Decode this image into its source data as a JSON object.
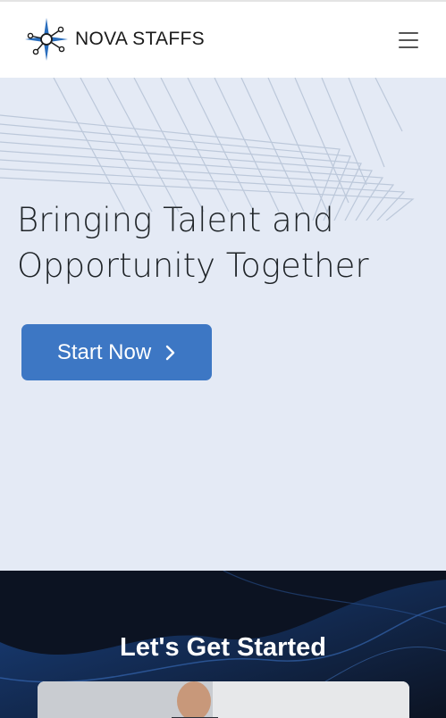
{
  "header": {
    "brand_name": "NOVA STAFFS",
    "logo_icon": "compass-star-network-icon",
    "menu_icon": "hamburger-menu-icon"
  },
  "hero": {
    "headline": "Bringing Talent and Opportunity Together",
    "cta_label": "Start Now",
    "cta_icon": "chevron-right-icon"
  },
  "get_started": {
    "title": "Let's Get Started",
    "image": "people-photo"
  },
  "colors": {
    "brand_blue": "#3d77c4",
    "hero_background": "#e4eaf5",
    "dark_background": "#0c1322",
    "text_dark": "#1f2428"
  }
}
